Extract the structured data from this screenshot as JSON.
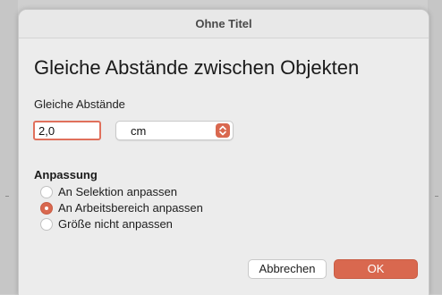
{
  "window": {
    "title": "Ohne Titel"
  },
  "dialog": {
    "heading": "Gleiche Abstände zwischen Objekten",
    "spacing_label": "Gleiche Abstände",
    "spacing_value": "2,0",
    "unit_value": "cm",
    "section_title": "Anpassung",
    "options": [
      {
        "label": "An Selektion anpassen",
        "selected": false
      },
      {
        "label": "An Arbeitsbereich anpassen",
        "selected": true
      },
      {
        "label": "Größe nicht anpassen",
        "selected": false
      }
    ],
    "cancel_label": "Abbrechen",
    "ok_label": "OK"
  },
  "colors": {
    "accent": "#d9684f",
    "dialog_bg": "#ececec"
  }
}
